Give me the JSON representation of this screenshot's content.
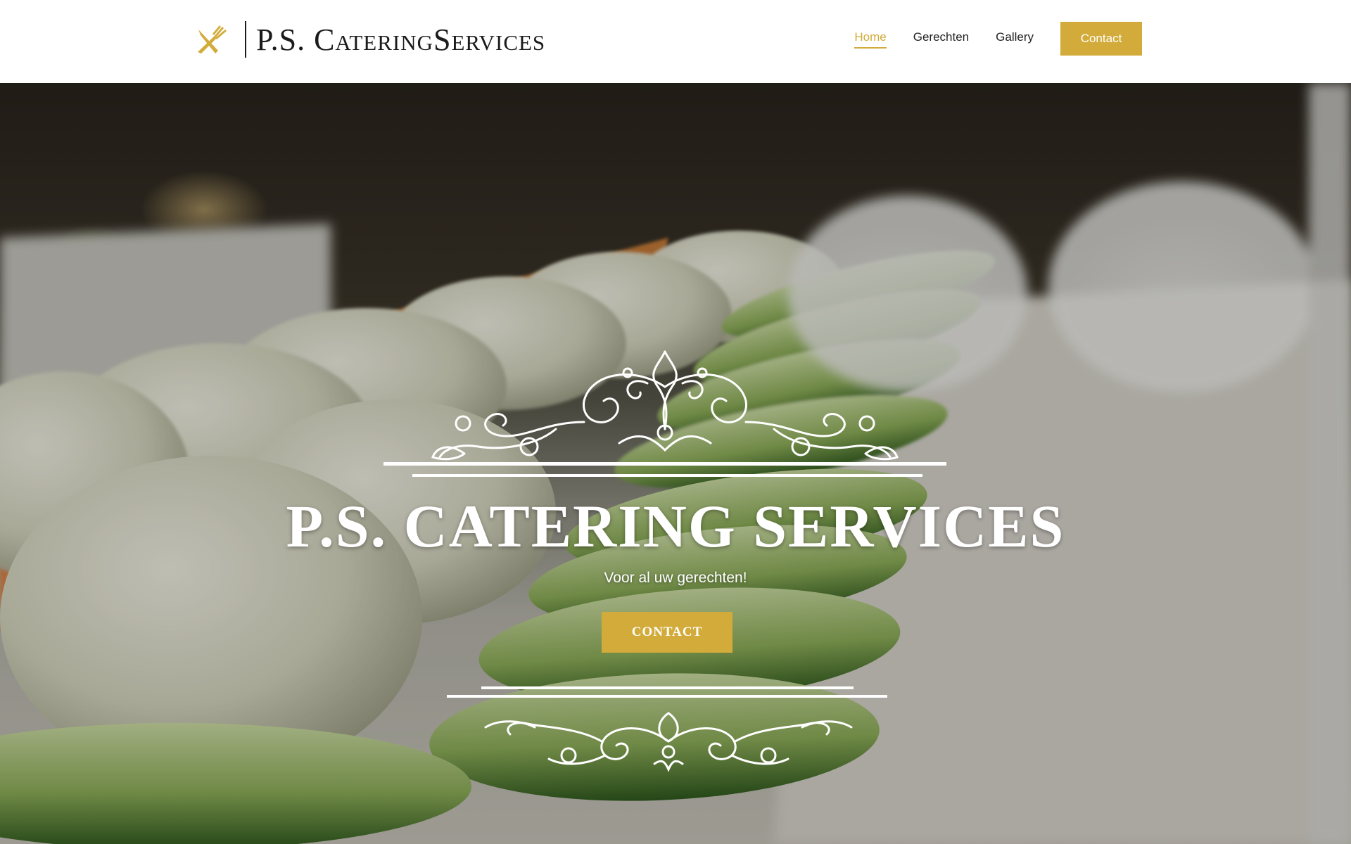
{
  "header": {
    "logo_text": "P.S. CateringServices",
    "logo_icon": "fork-knife-icon",
    "nav": [
      {
        "label": "Home",
        "active": true
      },
      {
        "label": "Gerechten",
        "active": false
      },
      {
        "label": "Gallery",
        "active": false
      }
    ],
    "contact_button": "Contact"
  },
  "hero": {
    "title": "P.S. CATERING SERVICES",
    "subtitle": "Voor al uw gerechten!",
    "button": "CONTACT",
    "ornament_icon": "flourish-ornament-icon"
  },
  "colors": {
    "accent": "#d2ab3a",
    "text_dark": "#1b1b1b",
    "white": "#ffffff"
  }
}
